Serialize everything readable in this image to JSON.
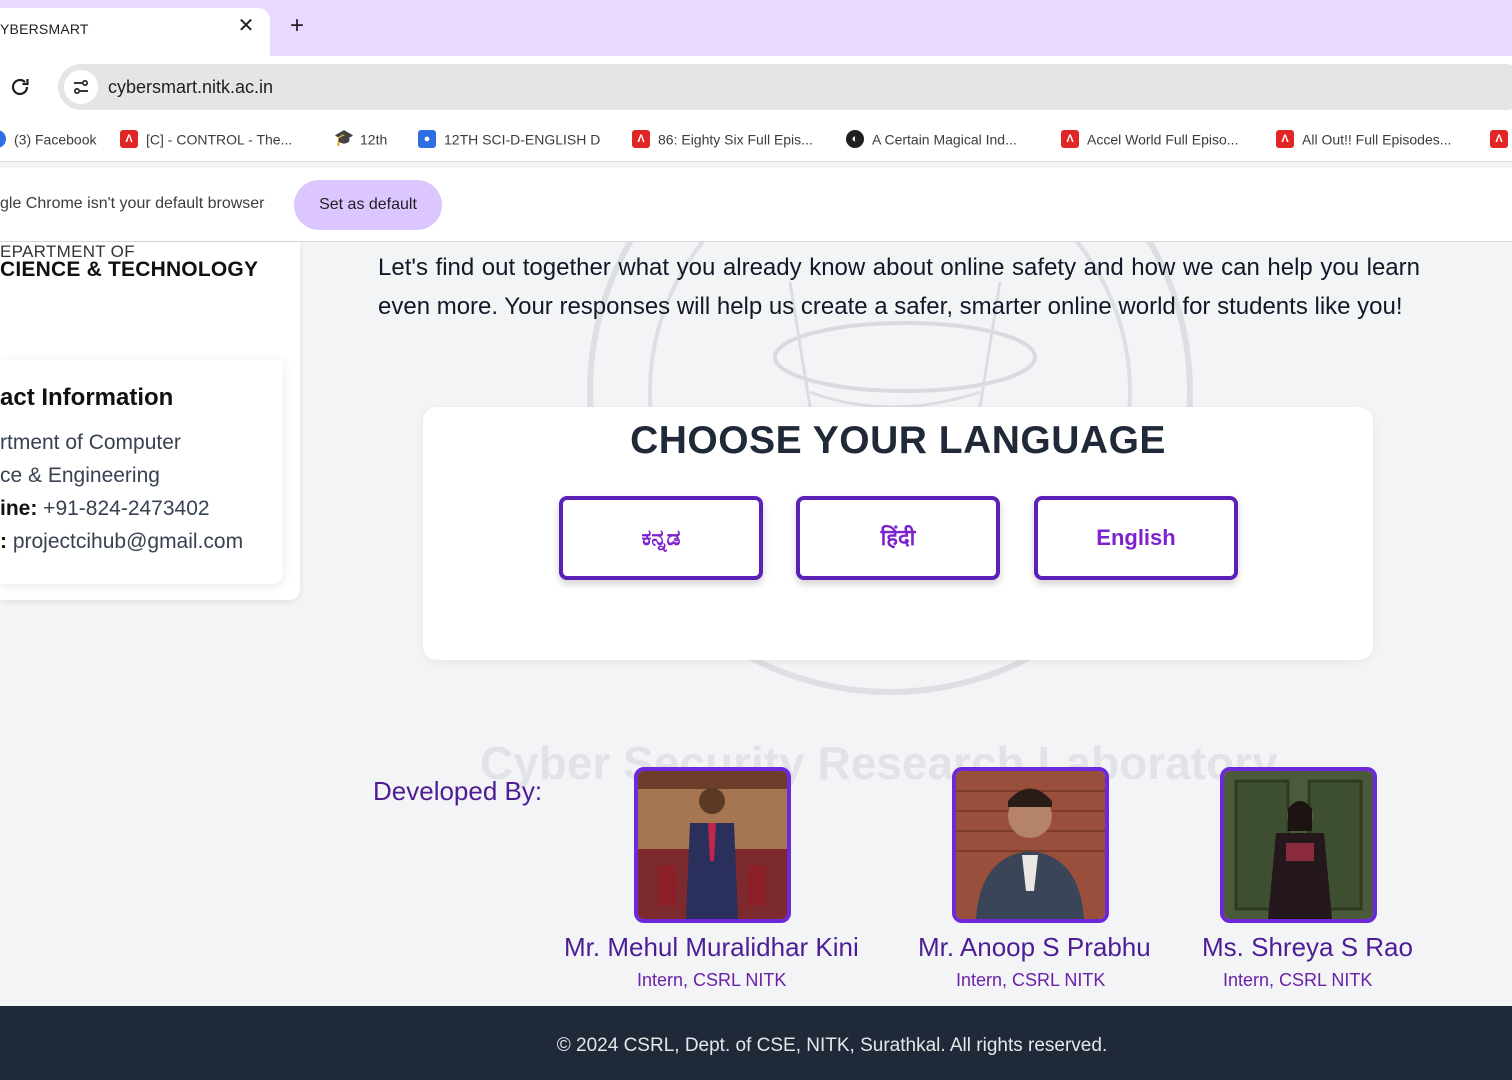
{
  "browser": {
    "tab_title": "YBERSMART",
    "tab_close": "✕",
    "new_tab": "+",
    "url": "cybersmart.nitk.ac.in",
    "bookmarks": [
      {
        "label": "(3) Facebook",
        "icon": "facebook-icon"
      },
      {
        "label": "[C] - CONTROL - The...",
        "icon": "red-a-icon"
      },
      {
        "label": "12th",
        "icon": "graduation-cap-icon"
      },
      {
        "label": "12TH SCI-D-ENGLISH D",
        "icon": "classroom-icon"
      },
      {
        "label": "86: Eighty Six Full Epis...",
        "icon": "red-a-icon"
      },
      {
        "label": "A Certain Magical Ind...",
        "icon": "globe-icon"
      },
      {
        "label": "Accel World Full Episo...",
        "icon": "red-a-icon"
      },
      {
        "label": "All Out!! Full Episodes...",
        "icon": "red-a-icon"
      }
    ],
    "infobar_text": "gle Chrome isn't your default browser",
    "set_default_label": "Set as default"
  },
  "sidebar": {
    "dept_line1": "EPARTMENT OF",
    "dept_line2": "CIENCE & TECHNOLOGY",
    "contact_title": "act Information",
    "address_line1": "rtment of Computer",
    "address_line2": "ce & Engineering",
    "phone_label": "ine:",
    "phone_value": " +91-824-2473402",
    "email_label": ":",
    "email_value": " projectcihub@gmail.com"
  },
  "main": {
    "intro": "Let's find out together what you already know about online safety and how we can help you learn even more. Your responses will help us create a safer, smarter online world for students like you!",
    "watermark_text": "Cyber Security Research Laboratory",
    "language": {
      "title": "CHOOSE YOUR LANGUAGE",
      "options": [
        "ಕನ್ನಡ",
        "हिंदी",
        "English"
      ]
    },
    "developers": {
      "label": "Developed By:",
      "people": [
        {
          "name": "Mr. Mehul Muralidhar Kini",
          "role": "Intern, CSRL NITK"
        },
        {
          "name": "Mr. Anoop S Prabhu",
          "role": "Intern, CSRL NITK"
        },
        {
          "name": "Ms. Shreya S Rao",
          "role": "Intern, CSRL NITK"
        }
      ]
    }
  },
  "footer": {
    "text": "© 2024 CSRL, Dept. of CSE, NITK, Surathkal. All rights reserved."
  },
  "colors": {
    "accent": "#5b21b6",
    "button_text": "#7e22ce",
    "tabstrip": "#e9d8ff",
    "footer_bg": "#1f2937"
  }
}
